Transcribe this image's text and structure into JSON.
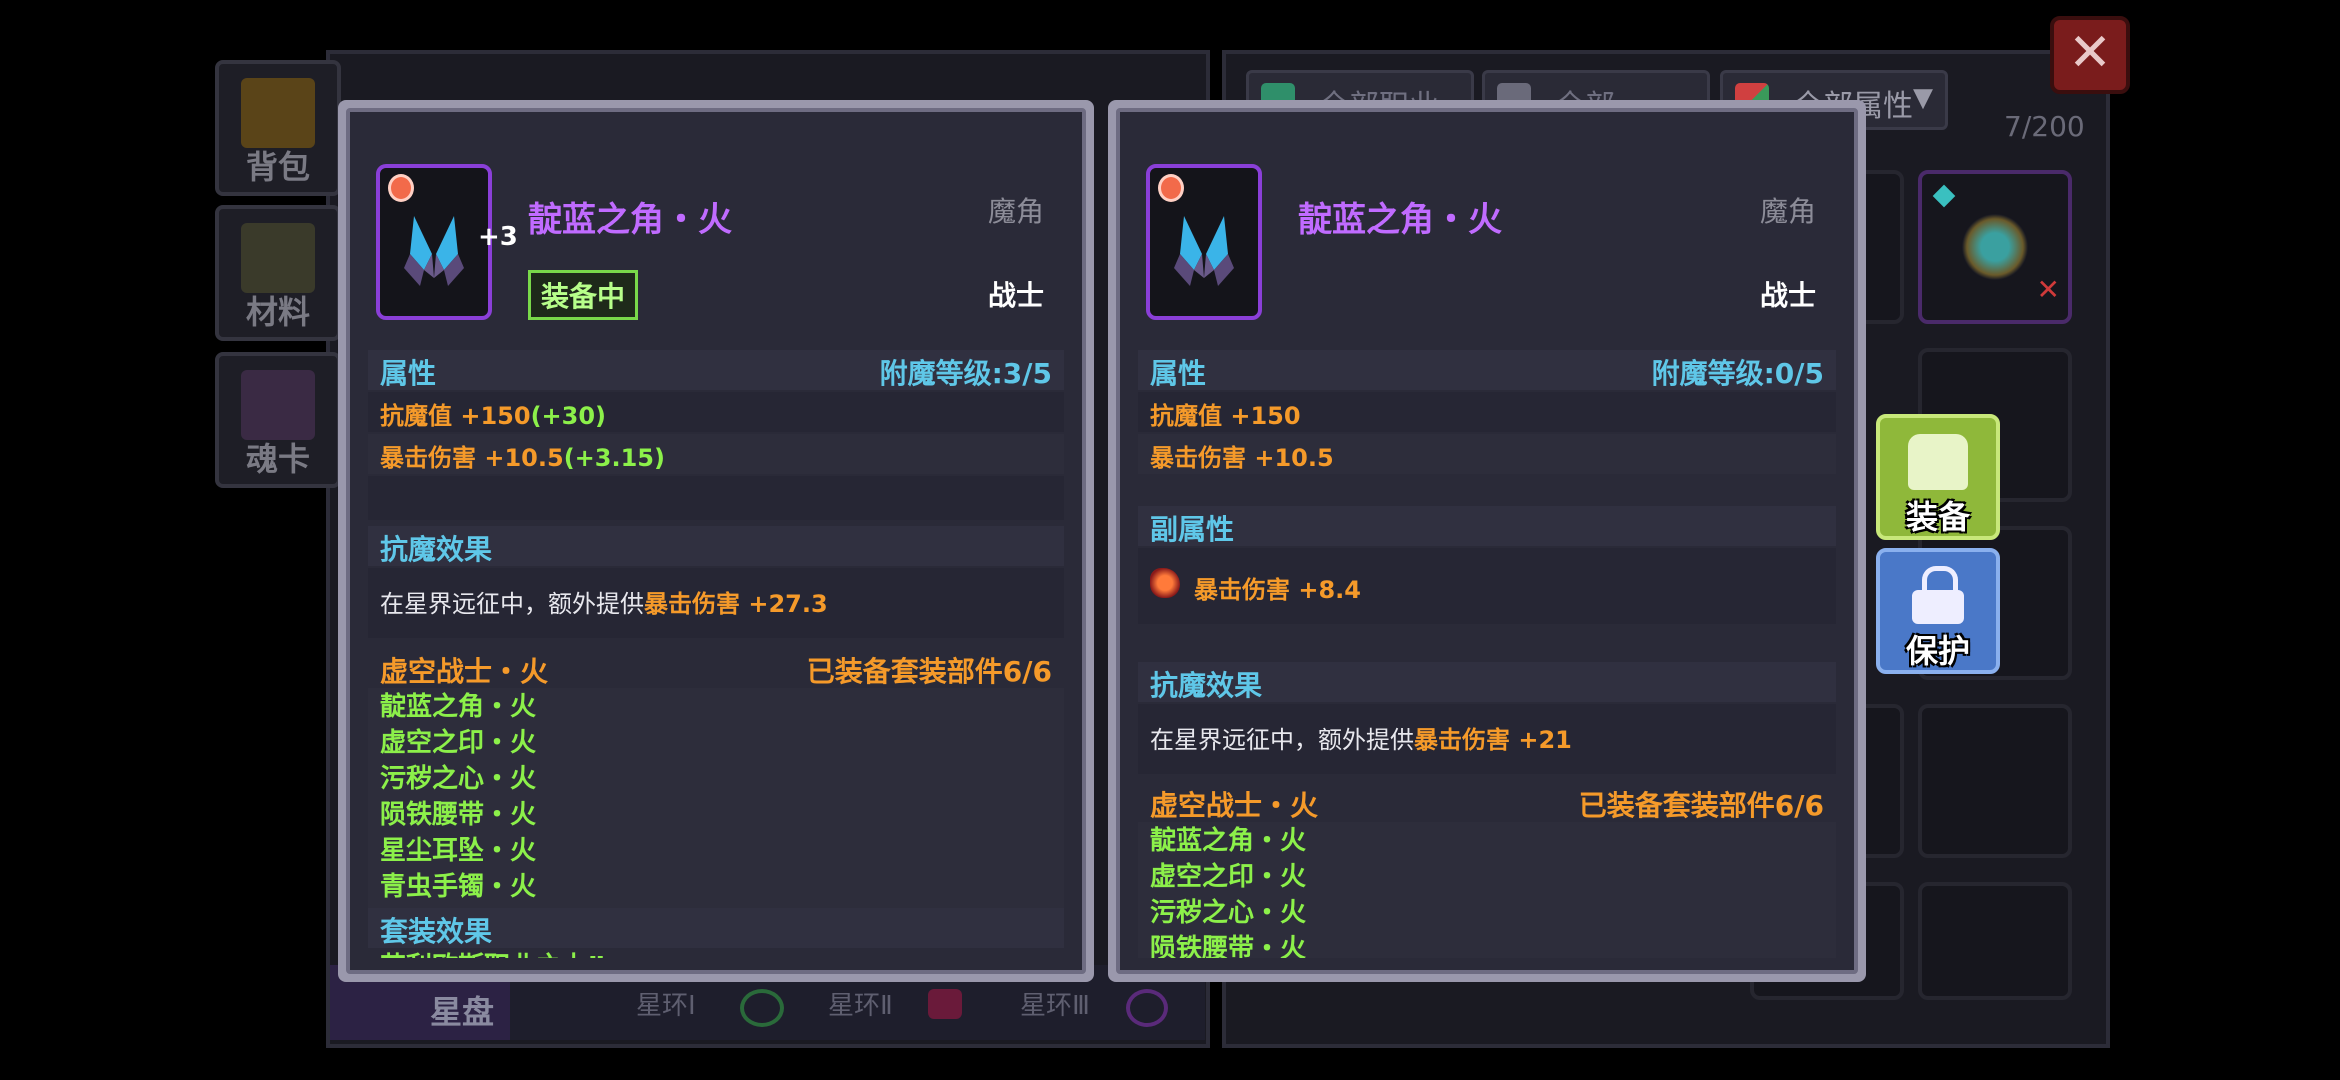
{
  "sidebar": {
    "tabs": [
      {
        "label": "背包"
      },
      {
        "label": "材料"
      },
      {
        "label": "魂卡"
      }
    ]
  },
  "filters": [
    {
      "label": "全部职业"
    },
    {
      "label": "全部"
    },
    {
      "label": "全部属性"
    }
  ],
  "inventory_count": "7/200",
  "actions": {
    "equip_label": "装备",
    "protect_label": "保护"
  },
  "star_bar": {
    "label": "星盘",
    "rings": [
      "星环Ⅰ",
      "星环Ⅱ",
      "星环Ⅲ"
    ]
  },
  "colors": {
    "name_purple": "#c06bff",
    "stat_orange": "#f59a2a",
    "bonus_green": "#8cf04a",
    "section_cyan": "#5fc7e8",
    "equip_button": "#8fb83a",
    "protect_button": "#4a78c8"
  },
  "left_card": {
    "name": "靛蓝之角・火",
    "upgrade": "+3",
    "type": "魔角",
    "class": "战士",
    "badge": "装备中",
    "attributes_title": "属性",
    "enchant_level": "附魔等级:3/5",
    "stats": [
      {
        "name": "抗魔值 +150",
        "bonus": "(+30)"
      },
      {
        "name": "暴击伤害 +10.5",
        "bonus": "(+3.15)"
      }
    ],
    "effect_title": "抗魔效果",
    "effect_prefix": "在星界远征中，额外提供",
    "effect_highlight": "暴击伤害 +27.3",
    "set_name": "虚空战士・火",
    "set_progress": "已装备套装部件6/6",
    "set_items": [
      "靛蓝之角・火",
      "虚空之印・火",
      "污秽之心・火",
      "陨铁腰带・火",
      "星尘耳坠・火",
      "青虫手镯・火"
    ],
    "set_effect_title": "套装效果",
    "set_effect_partial": "艾利欧斯职业之力Ⅱ"
  },
  "right_card": {
    "name": "靛蓝之角・火",
    "type": "魔角",
    "class": "战士",
    "attributes_title": "属性",
    "enchant_level": "附魔等级:0/5",
    "stats": [
      {
        "name": "抗魔值 +150"
      },
      {
        "name": "暴击伤害 +10.5"
      }
    ],
    "sub_title": "副属性",
    "sub_stat": "暴击伤害 +8.4",
    "effect_title": "抗魔效果",
    "effect_prefix": "在星界远征中，额外提供",
    "effect_highlight": "暴击伤害 +21",
    "set_name": "虚空战士・火",
    "set_progress": "已装备套装部件6/6",
    "set_items": [
      "靛蓝之角・火",
      "虚空之印・火",
      "污秽之心・火",
      "陨铁腰带・火"
    ]
  }
}
